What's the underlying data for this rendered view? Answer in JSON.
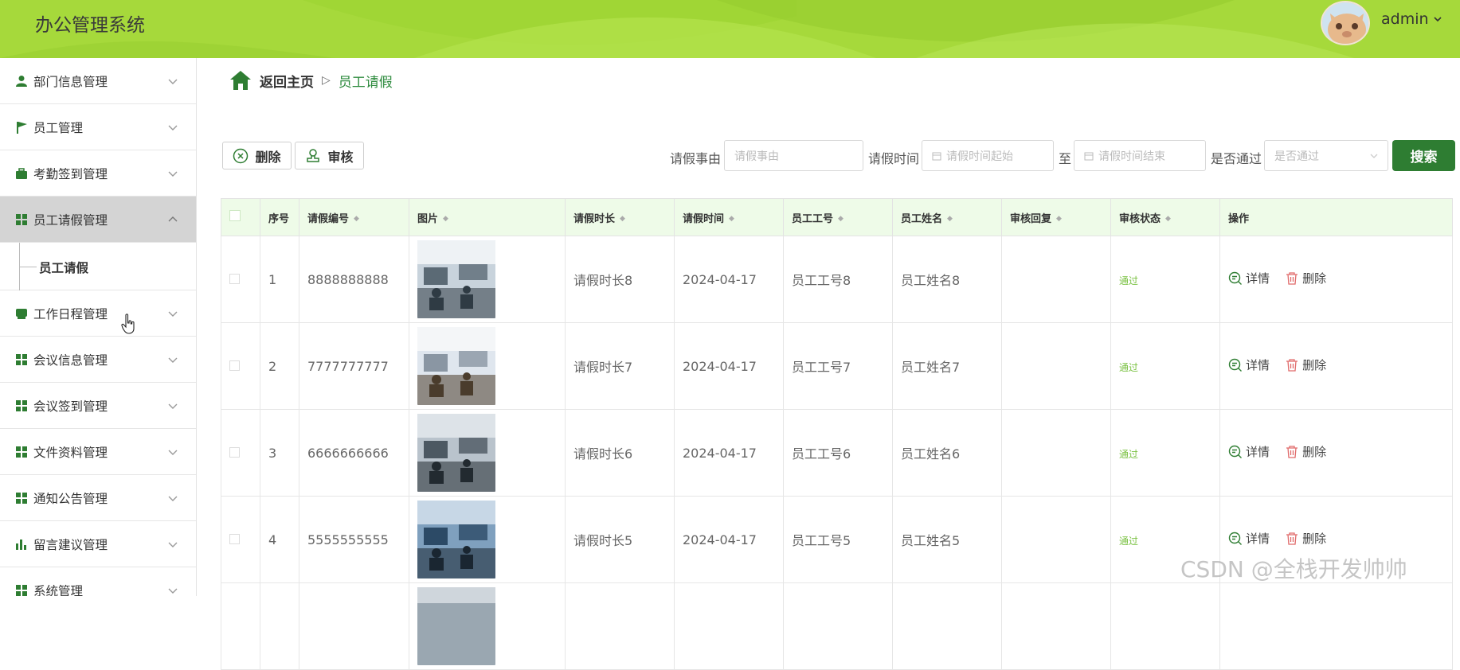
{
  "header": {
    "title": "办公管理系统",
    "username": "admin",
    "colors": {
      "background": "#a6d93b",
      "accent": "#2e7d32"
    }
  },
  "sidebar": {
    "items": [
      {
        "label": "部门信息管理",
        "icon": "user-icon"
      },
      {
        "label": "员工管理",
        "icon": "flag-icon"
      },
      {
        "label": "考勤签到管理",
        "icon": "briefcase-icon"
      },
      {
        "label": "员工请假管理",
        "icon": "grid-icon",
        "expanded": true
      },
      {
        "label": "工作日程管理",
        "icon": "calendar-icon"
      },
      {
        "label": "会议信息管理",
        "icon": "grid-icon"
      },
      {
        "label": "会议签到管理",
        "icon": "grid-icon"
      },
      {
        "label": "文件资料管理",
        "icon": "grid-icon"
      },
      {
        "label": "通知公告管理",
        "icon": "grid-icon"
      },
      {
        "label": "留言建议管理",
        "icon": "bar-chart-icon"
      },
      {
        "label": "系统管理",
        "icon": "grid-icon"
      }
    ],
    "submenu": {
      "label": "员工请假"
    }
  },
  "breadcrumb": {
    "home": "返回主页",
    "current": "员工请假"
  },
  "toolbar": {
    "delete_label": "删除",
    "audit_label": "审核"
  },
  "filters": {
    "reason_label": "请假事由",
    "reason_placeholder": "请假事由",
    "time_label": "请假时间",
    "time_start_placeholder": "请假时间起始",
    "to_label": "至",
    "time_end_placeholder": "请假时间结束",
    "passed_label": "是否通过",
    "passed_placeholder": "是否通过",
    "search_label": "搜索"
  },
  "table": {
    "columns": [
      "序号",
      "请假编号",
      "图片",
      "请假时长",
      "请假时间",
      "员工工号",
      "员工姓名",
      "审核回复",
      "审核状态",
      "操作"
    ],
    "rows": [
      {
        "index": "1",
        "code": "8888888888",
        "duration": "请假时长8",
        "date": "2024-04-17",
        "emp_no": "员工工号8",
        "emp_name": "员工姓名8",
        "reply": "",
        "status": "通过"
      },
      {
        "index": "2",
        "code": "7777777777",
        "duration": "请假时长7",
        "date": "2024-04-17",
        "emp_no": "员工工号7",
        "emp_name": "员工姓名7",
        "reply": "",
        "status": "通过"
      },
      {
        "index": "3",
        "code": "6666666666",
        "duration": "请假时长6",
        "date": "2024-04-17",
        "emp_no": "员工工号6",
        "emp_name": "员工姓名6",
        "reply": "",
        "status": "通过"
      },
      {
        "index": "4",
        "code": "5555555555",
        "duration": "请假时长5",
        "date": "2024-04-17",
        "emp_no": "员工工号5",
        "emp_name": "员工姓名5",
        "reply": "",
        "status": "通过"
      }
    ],
    "actions": {
      "detail": "详情",
      "delete": "删除"
    }
  },
  "watermark": "CSDN @全栈开发帅帅"
}
